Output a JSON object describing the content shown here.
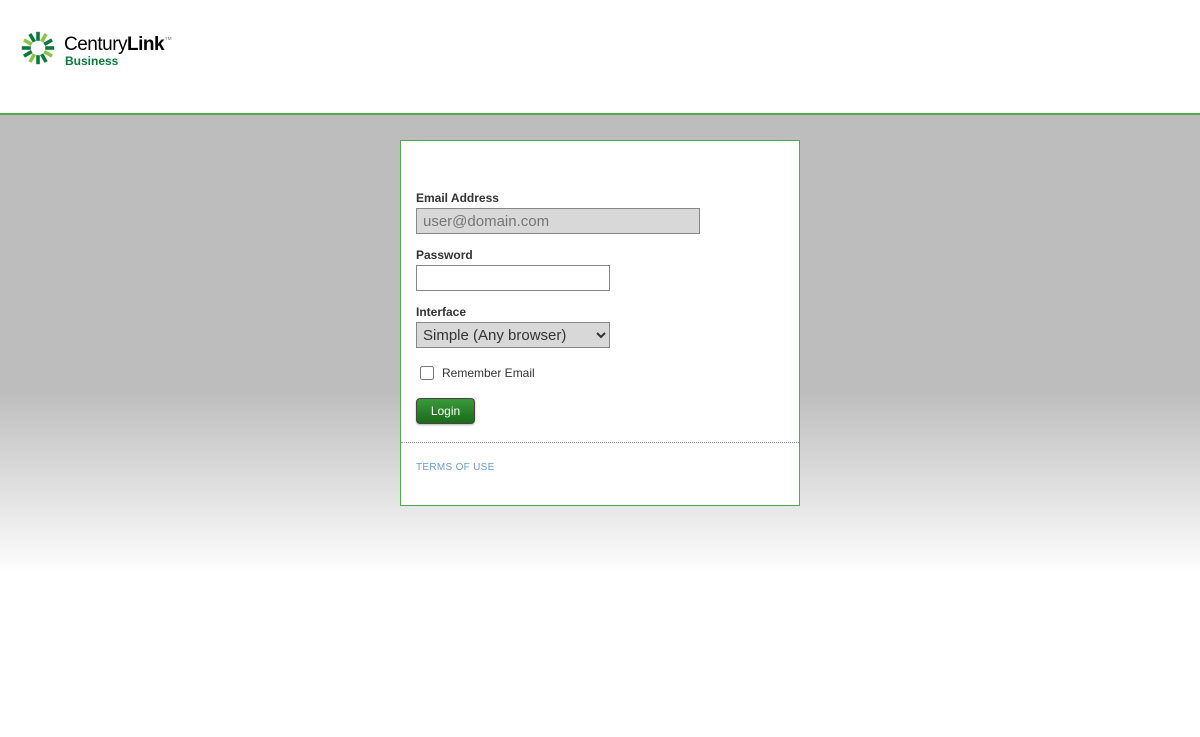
{
  "logo": {
    "brand_prefix": "Century",
    "brand_suffix": "Link",
    "tm": "™",
    "subtitle": "Business"
  },
  "form": {
    "email_label": "Email Address",
    "email_placeholder": "user@domain.com",
    "password_label": "Password",
    "interface_label": "Interface",
    "interface_selected": "Simple (Any browser)",
    "remember_label": "Remember Email",
    "login_button": "Login"
  },
  "footer": {
    "terms_link": "TERMS OF USE"
  }
}
